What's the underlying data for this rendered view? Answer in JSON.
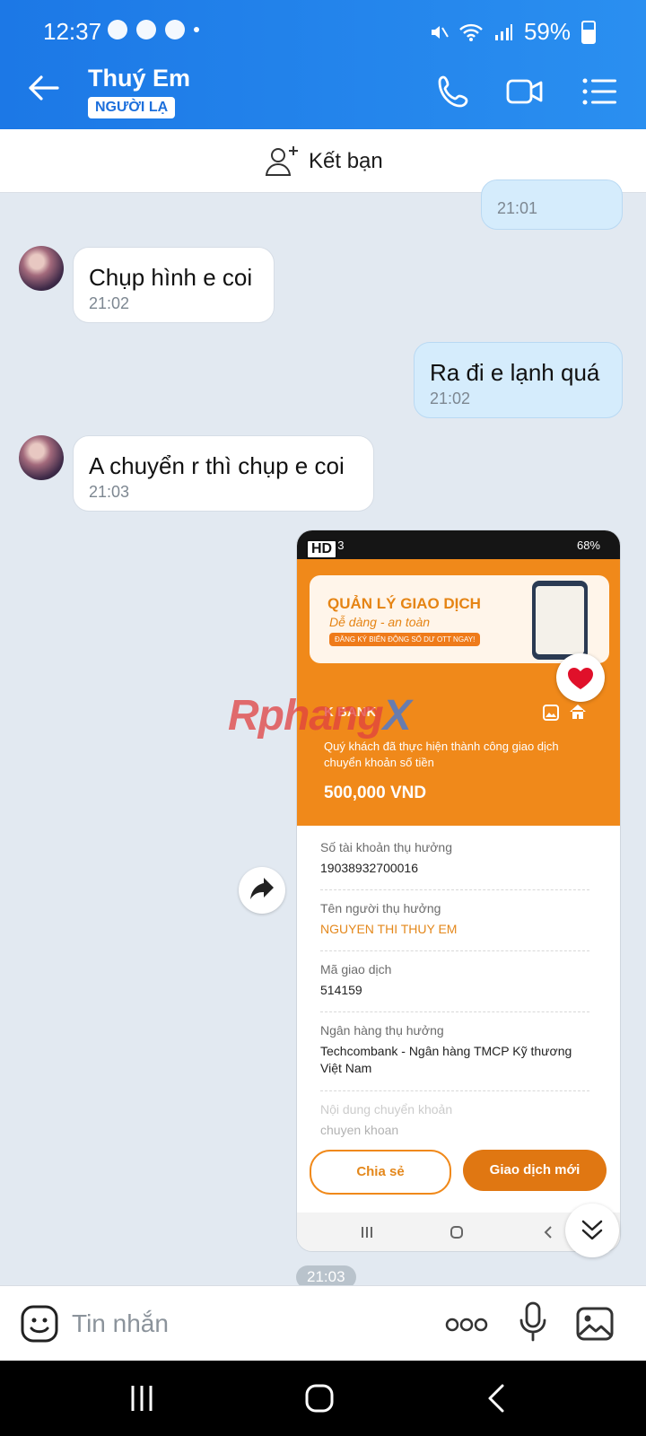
{
  "status_bar": {
    "time": "12:37",
    "battery": "59%"
  },
  "header": {
    "contact_name": "Thuý Em",
    "badge": "NGƯỜI LẠ"
  },
  "add_friend": {
    "label": "Kết bạn"
  },
  "messages": [
    {
      "direction": "out",
      "text": "",
      "time": "21:01"
    },
    {
      "direction": "in",
      "text": "Chụp hình e coi",
      "time": "21:02"
    },
    {
      "direction": "out",
      "text": "Ra đi e lạnh quá",
      "time": "21:02"
    },
    {
      "direction": "in",
      "text": "A chuyển r thì chụp e coi",
      "time": "21:03"
    }
  ],
  "image_message": {
    "hd_badge": "HD",
    "inner_status": {
      "time": "03",
      "battery": "68%"
    },
    "banner": {
      "title": "QUẢN LÝ GIAO DỊCH",
      "subtitle": "Dễ dàng - an toàn",
      "cta": "ĐĂNG KÝ BIẾN ĐỘNG SỐ DƯ OTT NGAY!"
    },
    "bank_logo": "K     BANK",
    "success_text": "Quý khách đã thực hiện thành công giao dịch chuyển khoản số tiền",
    "amount": "500,000 VND",
    "fields": [
      {
        "label": "Số tài khoản thụ hưởng",
        "value": "19038932700016"
      },
      {
        "label": "Tên người thụ hưởng",
        "value": "NGUYEN THI THUY EM"
      },
      {
        "label": "Mã giao dịch",
        "value": "514159"
      },
      {
        "label": "Ngân hàng thụ hưởng",
        "value": "Techcombank - Ngân hàng TMCP Kỹ thương Việt Nam"
      },
      {
        "label": "Nội dung chuyển khoản",
        "value": "chuyen khoan"
      }
    ],
    "share_label": "Chia sẻ",
    "new_tx_label": "Giao dịch mới",
    "time": "21:03"
  },
  "watermark": {
    "part1": "Rphang",
    "part2": "X"
  },
  "composer": {
    "placeholder": "Tin nhắn"
  },
  "colors": {
    "accent": "#1c78e6",
    "bank_orange": "#f0891a",
    "out_bubble": "#d5ecfc"
  }
}
